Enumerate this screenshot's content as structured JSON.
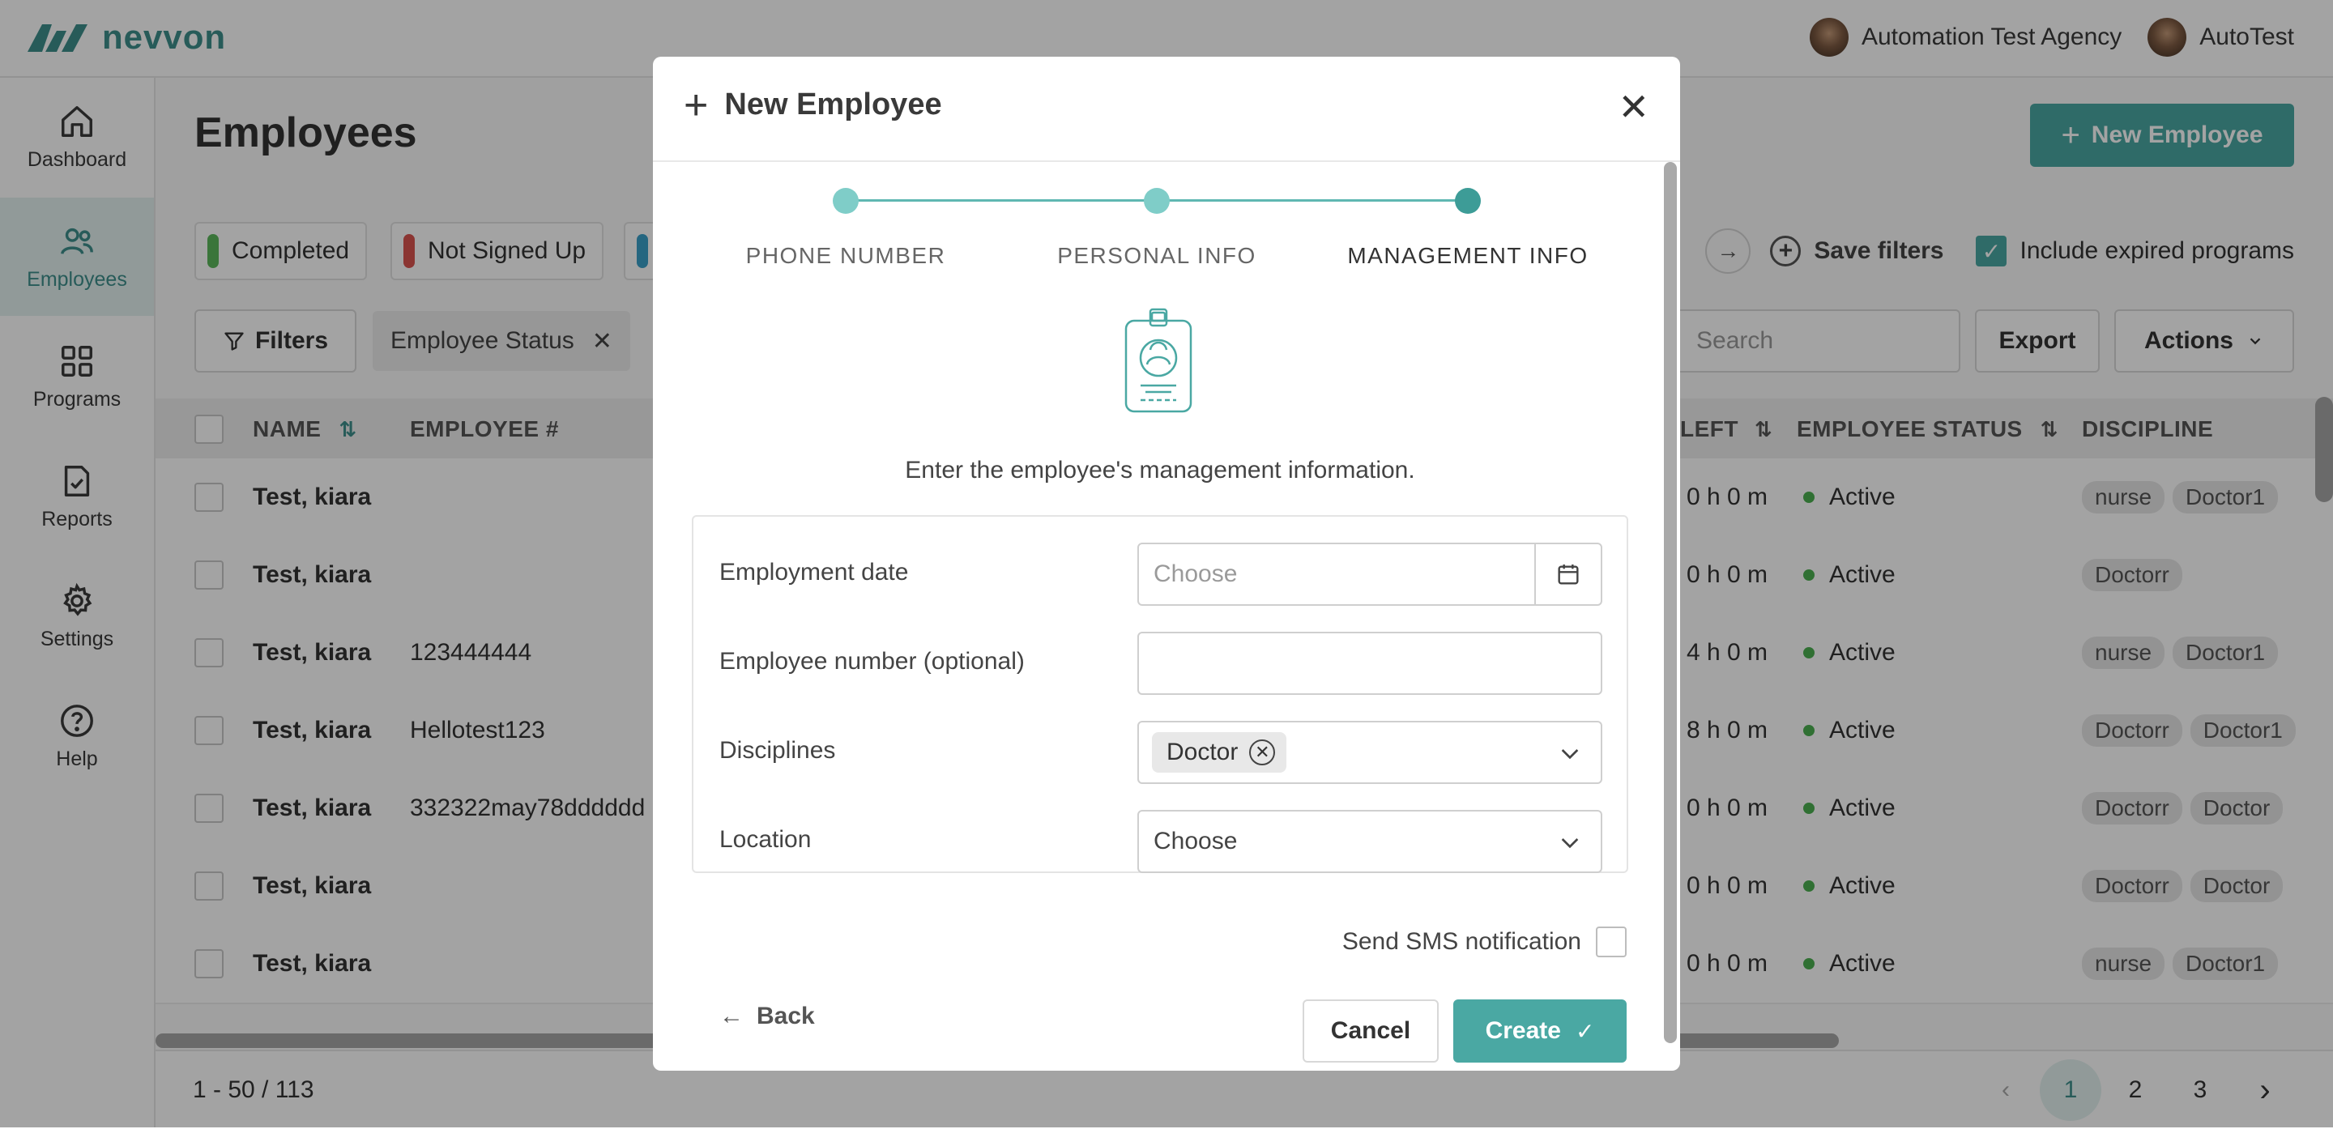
{
  "app": {
    "brand": "nevvon",
    "agency": "Automation Test Agency",
    "user": "AutoTest"
  },
  "sidebar": {
    "items": [
      {
        "label": "Dashboard",
        "icon": "home-icon"
      },
      {
        "label": "Employees",
        "icon": "users-icon",
        "active": true
      },
      {
        "label": "Programs",
        "icon": "grid-icon"
      },
      {
        "label": "Reports",
        "icon": "report-icon"
      },
      {
        "label": "Settings",
        "icon": "gear-icon"
      },
      {
        "label": "Help",
        "icon": "help-icon"
      }
    ]
  },
  "page": {
    "title": "Employees",
    "new_button": "New Employee",
    "status_chips": [
      {
        "label": "Completed",
        "color": "#5cb85c"
      },
      {
        "label": "Not Signed Up",
        "color": "#d9534f"
      },
      {
        "label": "",
        "color": "#3aa0c8"
      }
    ],
    "save_filters": "Save filters",
    "include_expired": "Include expired programs",
    "filters_button": "Filters",
    "active_filter": "Employee Status",
    "search_placeholder": "Search",
    "export_button": "Export",
    "actions_button": "Actions"
  },
  "table": {
    "columns": {
      "name": "NAME",
      "employee_no": "EMPLOYEE #",
      "left": "LEFT",
      "status": "EMPLOYEE STATUS",
      "discipline": "DISCIPLINE"
    },
    "rows": [
      {
        "name": "Test, kiara",
        "emp_no": "",
        "left": "0 h 0 m",
        "status": "Active",
        "d1": "nurse",
        "d2": "Doctor1"
      },
      {
        "name": "Test, kiara",
        "emp_no": "",
        "left": "0 h 0 m",
        "status": "Active",
        "d1": "Doctorr",
        "d2": ""
      },
      {
        "name": "Test, kiara",
        "emp_no": "123444444",
        "left": "4 h 0 m",
        "status": "Active",
        "d1": "nurse",
        "d2": "Doctor1"
      },
      {
        "name": "Test, kiara",
        "emp_no": "Hellotest123",
        "left": "8 h 0 m",
        "status": "Active",
        "d1": "Doctorr",
        "d2": "Doctor1"
      },
      {
        "name": "Test, kiara",
        "emp_no": "332322may78dddddd",
        "left": "0 h 0 m",
        "status": "Active",
        "d1": "Doctorr",
        "d2": "Doctor"
      },
      {
        "name": "Test, kiara",
        "emp_no": "",
        "left": "0 h 0 m",
        "status": "Active",
        "d1": "Doctorr",
        "d2": "Doctor"
      },
      {
        "name": "Test, kiara",
        "emp_no": "",
        "left": "0 h 0 m",
        "status": "Active",
        "d1": "nurse",
        "d2": "Doctor1"
      }
    ]
  },
  "footer": {
    "range": "1 - 50 / 113",
    "pages": [
      "1",
      "2",
      "3"
    ],
    "current_page": "1"
  },
  "modal": {
    "title": "New Employee",
    "steps": [
      {
        "label": "PHONE NUMBER"
      },
      {
        "label": "PERSONAL INFO"
      },
      {
        "label": "MANAGEMENT INFO",
        "current": true
      }
    ],
    "intro": "Enter the employee's management information.",
    "fields": {
      "employment_date": {
        "label": "Employment date",
        "placeholder": "Choose"
      },
      "employee_number": {
        "label": "Employee number (optional)",
        "value": ""
      },
      "disciplines": {
        "label": "Disciplines",
        "selected": [
          "Doctor"
        ]
      },
      "location": {
        "label": "Location",
        "placeholder": "Choose"
      }
    },
    "sms_label": "Send SMS notification",
    "sms_checked": false,
    "back": "Back",
    "cancel": "Cancel",
    "create": "Create"
  }
}
